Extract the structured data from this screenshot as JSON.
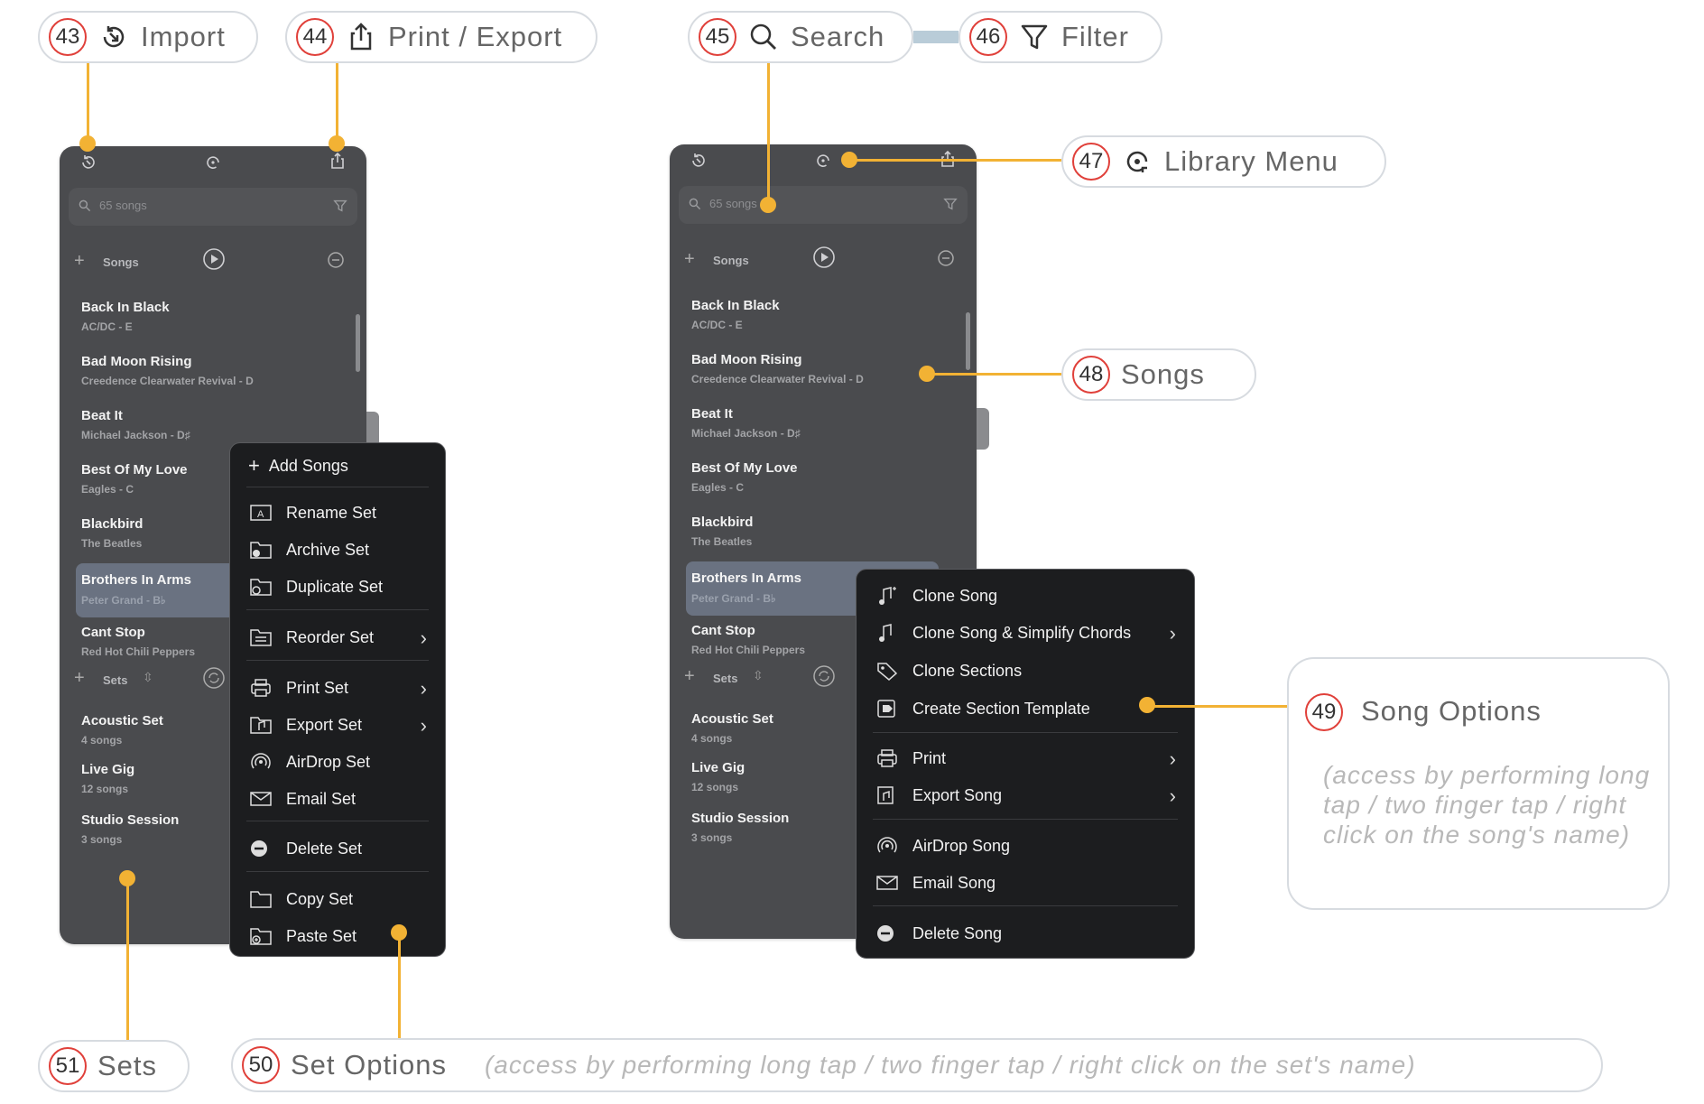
{
  "callouts": {
    "c43": {
      "num": "43",
      "label": "Import",
      "icon": "import-icon"
    },
    "c44": {
      "num": "44",
      "label": "Print / Export",
      "icon": "share-icon"
    },
    "c45": {
      "num": "45",
      "label": "Search",
      "icon": "search-icon"
    },
    "c46": {
      "num": "46",
      "label": "Filter",
      "icon": "filter-icon"
    },
    "c47": {
      "num": "47",
      "label": "Library Menu",
      "icon": "library-menu-icon"
    },
    "c48": {
      "num": "48",
      "label": "Songs"
    },
    "c49": {
      "num": "49",
      "label": "Song Options",
      "note": "(access by performing long tap / two finger tap / right click on the song's name)"
    },
    "c50": {
      "num": "50",
      "label": "Set Options",
      "note": "(access by performing long tap / two finger tap / right click on the set's name)"
    },
    "c51": {
      "num": "51",
      "label": "Sets"
    }
  },
  "library": {
    "search_placeholder": "65 songs",
    "songs_header": "Songs",
    "sets_header": "Sets",
    "songs": [
      {
        "title": "Back In Black",
        "subtitle": "AC/DC - E"
      },
      {
        "title": "Bad Moon Rising",
        "subtitle": "Creedence Clearwater Revival - D"
      },
      {
        "title": "Beat It",
        "subtitle": "Michael Jackson - D♯"
      },
      {
        "title": "Best Of My Love",
        "subtitle": "Eagles - C"
      },
      {
        "title": "Blackbird",
        "subtitle": "The Beatles"
      },
      {
        "title": "Brothers In Arms",
        "subtitle": "Peter Grand - B♭"
      },
      {
        "title": "Cant Stop",
        "subtitle": "Red Hot Chili Peppers"
      }
    ],
    "sets": [
      {
        "title": "Acoustic Set",
        "subtitle": "4 songs"
      },
      {
        "title": "Live Gig",
        "subtitle": "12 songs"
      },
      {
        "title": "Studio Session",
        "subtitle": "3 songs"
      }
    ]
  },
  "set_menu": {
    "add": "Add Songs",
    "rename": "Rename Set",
    "archive": "Archive Set",
    "duplicate": "Duplicate Set",
    "reorder": "Reorder Set",
    "print": "Print Set",
    "export": "Export Set",
    "airdrop": "AirDrop Set",
    "email": "Email Set",
    "delete": "Delete Set",
    "copy": "Copy Set",
    "paste": "Paste Set"
  },
  "song_menu": {
    "clone": "Clone Song",
    "clone_simplify": "Clone Song & Simplify Chords",
    "clone_sections": "Clone Sections",
    "section_template": "Create Section Template",
    "print": "Print",
    "export": "Export Song",
    "airdrop": "AirDrop Song",
    "email": "Email Song",
    "delete": "Delete Song"
  },
  "colors": {
    "accent": "#f2b234",
    "badge_ring": "#e0403a",
    "panel": "#4a4b4e",
    "menu": "#1c1d1f",
    "selected_row": "#6a7281"
  }
}
